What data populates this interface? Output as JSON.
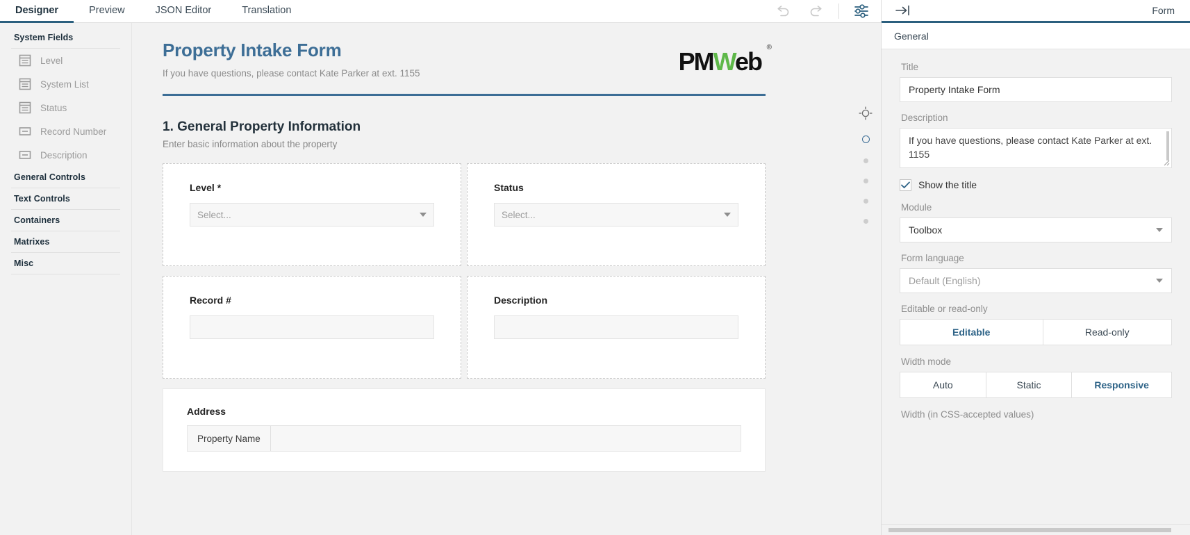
{
  "topbar": {
    "tabs": [
      {
        "label": "Designer",
        "active": true
      },
      {
        "label": "Preview",
        "active": false
      },
      {
        "label": "JSON Editor",
        "active": false
      },
      {
        "label": "Translation",
        "active": false
      }
    ],
    "undo_icon": "undo-icon",
    "redo_icon": "redo-icon",
    "settings_icon": "sliders-settings-icon",
    "accent_color": "#2b5f7e"
  },
  "sidebar": {
    "groups": [
      {
        "title": "System Fields",
        "items": [
          {
            "label": "Level",
            "icon": "list-field-icon"
          },
          {
            "label": "System List",
            "icon": "list-field-icon"
          },
          {
            "label": "Status",
            "icon": "list-field-icon"
          },
          {
            "label": "Record Number",
            "icon": "text-field-icon"
          },
          {
            "label": "Description",
            "icon": "text-field-icon"
          }
        ]
      },
      {
        "title": "General Controls",
        "items": []
      },
      {
        "title": "Text Controls",
        "items": []
      },
      {
        "title": "Containers",
        "items": []
      },
      {
        "title": "Matrixes",
        "items": []
      },
      {
        "title": "Misc",
        "items": []
      }
    ]
  },
  "form": {
    "title": "Property Intake Form",
    "subtitle": "If you have questions, please contact Kate Parker at ext. 1155",
    "title_color": "#3d6e96",
    "logo": {
      "part1": "PM",
      "part2": "W",
      "part3": "eb",
      "registered": "®",
      "green": "#5eb849"
    },
    "section": {
      "heading": "1. General Property Information",
      "subheading": "Enter basic information about the property"
    },
    "fields": [
      {
        "label": "Level *",
        "type": "select",
        "placeholder": "Select..."
      },
      {
        "label": "Status",
        "type": "select",
        "placeholder": "Select..."
      },
      {
        "label": "Record #",
        "type": "text",
        "placeholder": ""
      },
      {
        "label": "Description",
        "type": "text",
        "placeholder": ""
      }
    ],
    "address": {
      "label": "Address",
      "columns": [
        "Property Name"
      ]
    }
  },
  "dot_rail": {
    "target_icon": "target-crosshair-icon",
    "dots": [
      "selected",
      "plain",
      "plain",
      "plain",
      "plain"
    ],
    "selected_color": "#3d6e96"
  },
  "properties": {
    "header_title": "Form",
    "collapse_icon": "collapse-panel-right-icon",
    "tab": "General",
    "title_label": "Title",
    "title_value": "Property Intake Form",
    "description_label": "Description",
    "description_value": "If you have questions, please contact Kate Parker at ext. 1155",
    "show_title_label": "Show the title",
    "show_title_checked": true,
    "module_label": "Module",
    "module_value": "Toolbox",
    "form_language_label": "Form language",
    "form_language_value": "Default (English)",
    "editable_label": "Editable or read-only",
    "editable_options": [
      {
        "label": "Editable",
        "selected": true
      },
      {
        "label": "Read-only",
        "selected": false
      }
    ],
    "width_mode_label": "Width mode",
    "width_mode_options": [
      {
        "label": "Auto",
        "selected": false
      },
      {
        "label": "Static",
        "selected": false
      },
      {
        "label": "Responsive",
        "selected": true
      }
    ],
    "width_css_label": "Width (in CSS-accepted values)"
  }
}
